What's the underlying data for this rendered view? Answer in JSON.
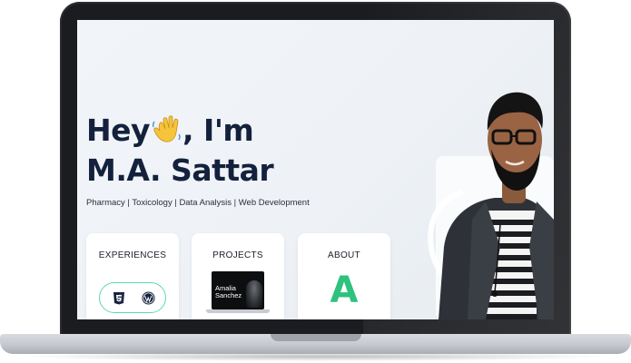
{
  "hero": {
    "line1_before": "Hey",
    "line1_after": ", I'm",
    "line2": "M.A. Sattar",
    "wave_icon": "waving-hand-icon"
  },
  "tagline": "Pharmacy | Toxicology | Data Analysis | Web Development",
  "cards": {
    "experiences": {
      "title": "EXPERIENCES",
      "icons": [
        "html5-icon",
        "wordpress-icon"
      ]
    },
    "projects": {
      "title": "PROJECTS",
      "preview_name": "Amalia Sanchez"
    },
    "about": {
      "title": "ABOUT",
      "logo_letter": "A"
    }
  },
  "colors": {
    "heading": "#14213d",
    "accent_green": "#2ec27e",
    "pill_border": "#5ed7b0",
    "background": "#eef2f6"
  }
}
